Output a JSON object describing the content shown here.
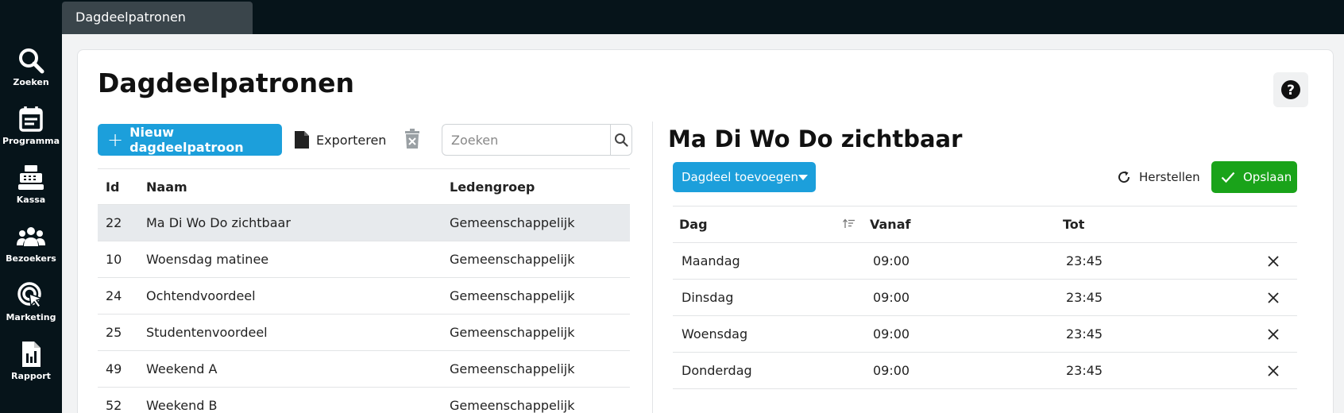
{
  "nav": {
    "items": [
      {
        "label": "Zoeken",
        "icon": "search-icon"
      },
      {
        "label": "Programma",
        "icon": "calendar-icon"
      },
      {
        "label": "Kassa",
        "icon": "cash-register-icon"
      },
      {
        "label": "Bezoekers",
        "icon": "users-icon"
      },
      {
        "label": "Marketing",
        "icon": "target-cursor-icon"
      },
      {
        "label": "Rapport",
        "icon": "report-icon"
      }
    ]
  },
  "tabs": [
    {
      "label": "Dagdeelpatronen"
    }
  ],
  "page": {
    "title": "Dagdeelpatronen"
  },
  "toolbar": {
    "new_label": "Nieuw dagdeelpatroon",
    "export_label": "Exporteren",
    "search_placeholder": "Zoeken"
  },
  "list": {
    "columns": {
      "id": "Id",
      "naam": "Naam",
      "ledengroep": "Ledengroep"
    },
    "rows": [
      {
        "id": "22",
        "naam": "Ma Di Wo Do zichtbaar",
        "ledengroep": "Gemeenschappelijk",
        "selected": true
      },
      {
        "id": "10",
        "naam": "Woensdag matinee",
        "ledengroep": "Gemeenschappelijk"
      },
      {
        "id": "24",
        "naam": "Ochtendvoordeel",
        "ledengroep": "Gemeenschappelijk"
      },
      {
        "id": "25",
        "naam": "Studentenvoordeel",
        "ledengroep": "Gemeenschappelijk"
      },
      {
        "id": "49",
        "naam": "Weekend A",
        "ledengroep": "Gemeenschappelijk"
      },
      {
        "id": "52",
        "naam": "Weekend B",
        "ledengroep": "Gemeenschappelijk"
      }
    ]
  },
  "detail": {
    "title": "Ma Di Wo Do zichtbaar",
    "add_label": "Dagdeel toevoegen",
    "reset_label": "Herstellen",
    "save_label": "Opslaan",
    "columns": {
      "dag": "Dag",
      "vanaf": "Vanaf",
      "tot": "Tot"
    },
    "rows": [
      {
        "dag": "Maandag",
        "vanaf": "09:00",
        "tot": "23:45"
      },
      {
        "dag": "Dinsdag",
        "vanaf": "09:00",
        "tot": "23:45"
      },
      {
        "dag": "Woensdag",
        "vanaf": "09:00",
        "tot": "23:45"
      },
      {
        "dag": "Donderdag",
        "vanaf": "09:00",
        "tot": "23:45"
      }
    ]
  },
  "colors": {
    "sidebar_bg": "#06141a",
    "tab_bg": "#3a454b",
    "primary": "#1c9fdb",
    "success": "#1aa31a",
    "selected_row": "#e7eaed"
  }
}
